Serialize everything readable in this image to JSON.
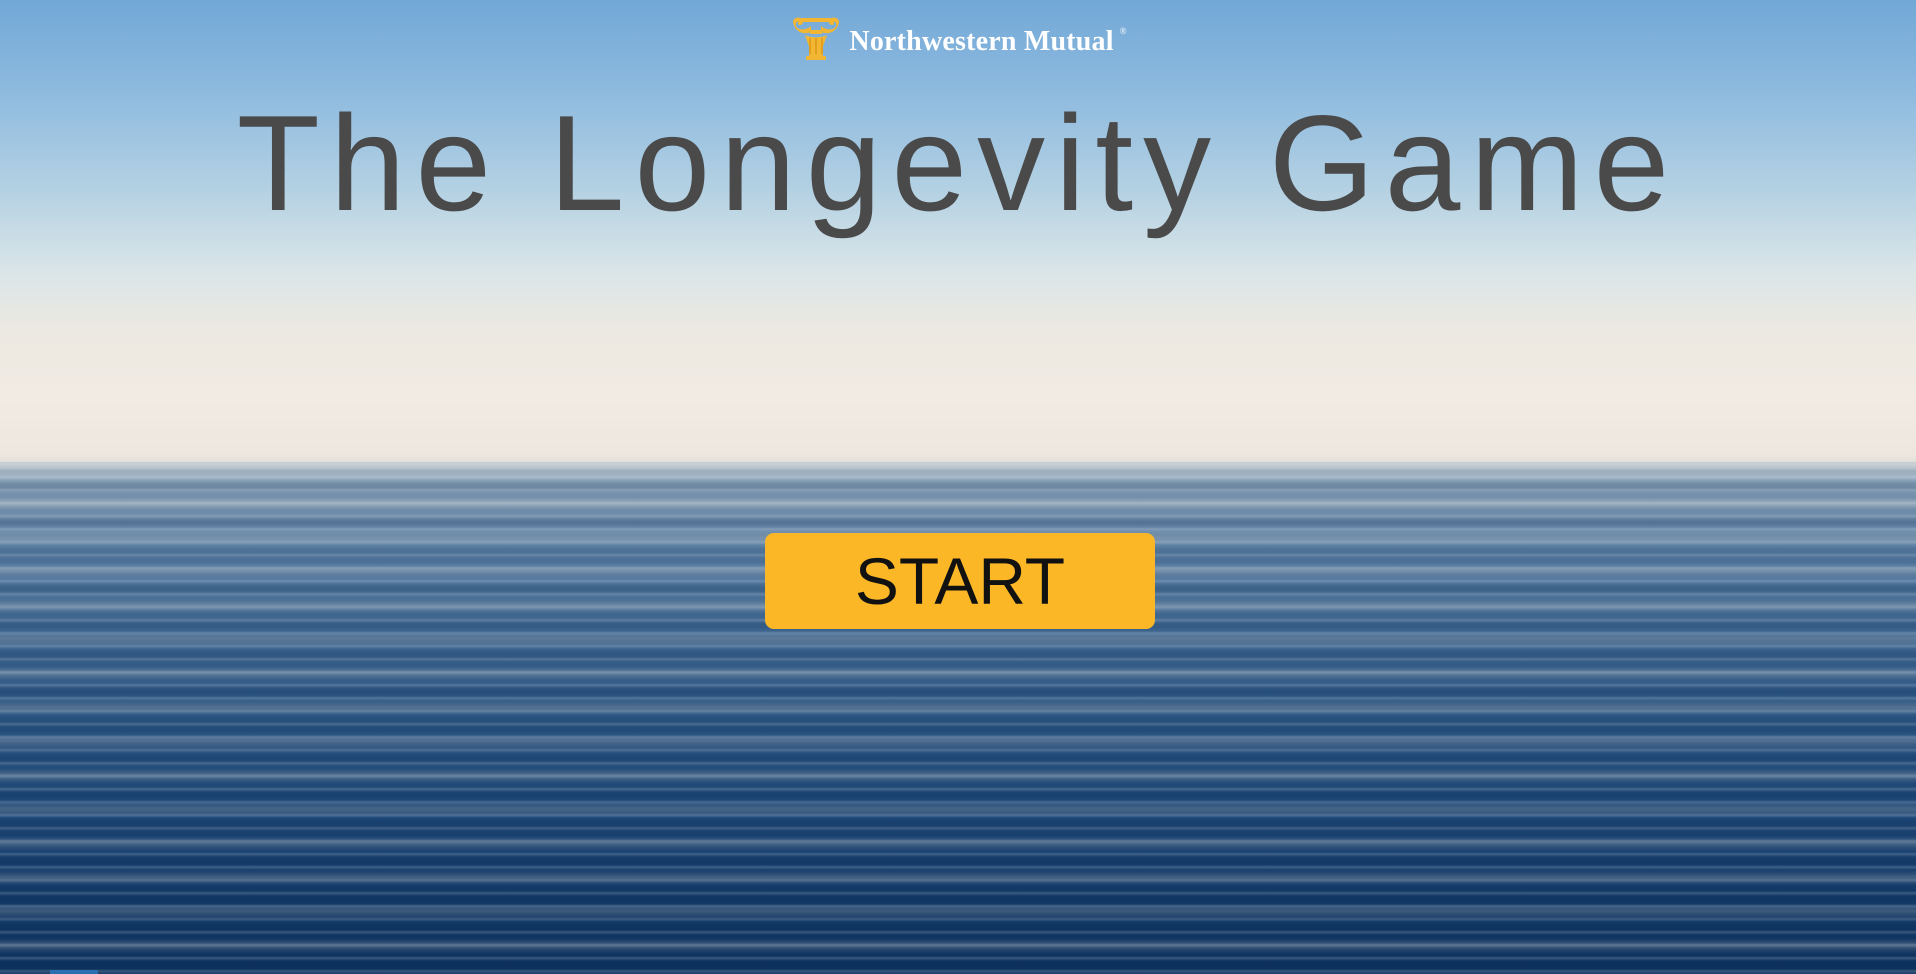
{
  "brand": {
    "name": "Northwestern Mutual",
    "registered_mark": "®",
    "logo_icon": "capital-column-icon",
    "logo_color": "#f2b632"
  },
  "game": {
    "title": "The Longevity Game"
  },
  "actions": {
    "start_label": "START"
  },
  "colors": {
    "button": "#fbb726",
    "title_text": "#4a4a4a",
    "sky_top": "#72a8d6",
    "horizon": "#f1ebe3",
    "sea_deep": "#0e335f"
  }
}
